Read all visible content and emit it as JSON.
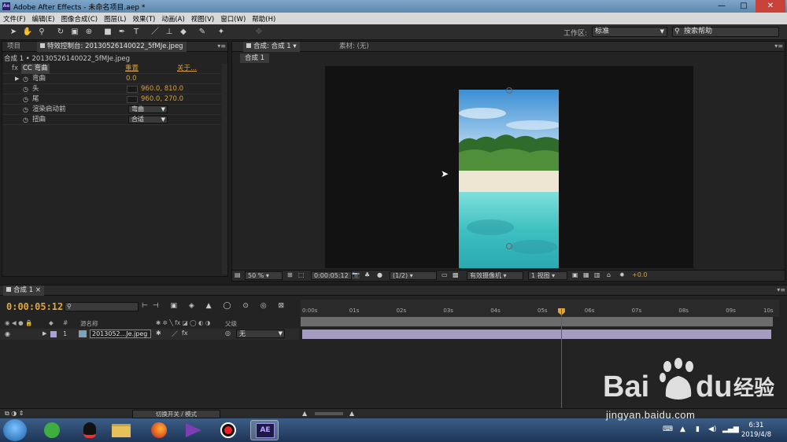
{
  "window": {
    "title": "Adobe After Effects - 未命名项目.aep *",
    "minimize": "—",
    "maximize": "□",
    "close": "✕"
  },
  "menu": [
    "文件(F)",
    "编辑(E)",
    "图像合成(C)",
    "图层(L)",
    "效果(T)",
    "动画(A)",
    "视图(V)",
    "窗口(W)",
    "帮助(H)"
  ],
  "toolbar": {
    "workspace_label": "工作区:",
    "workspace_value": "标准",
    "search_placeholder": "搜索帮助"
  },
  "left_panel": {
    "tab_project": "项目",
    "tab_effect_controls": "特效控制台: 20130526140022_5fMJe.jpeg",
    "subheader": "合成 1 • 20130526140022_5fMJe.jpeg",
    "effect_name": "CC 弯曲",
    "reset": "重置",
    "about": "关于...",
    "properties": {
      "bend_label": "弯曲",
      "bend_value": "0.0",
      "head_label": "头",
      "head_value": "960.0, 810.0",
      "tail_label": "尾",
      "tail_value": "960.0, 270.0",
      "render_prestart_label": "渲染启动前",
      "render_prestart_value": "弯曲",
      "distort_label": "扭曲",
      "distort_value": "合适"
    }
  },
  "comp_panel": {
    "tab_comp": "合成: 合成 1",
    "tab_footage": "素材: (无)",
    "subtab": "合成 1",
    "footer": {
      "zoom": "50 %",
      "timecode": "0:00:05:12",
      "resolution": "(1/2)",
      "camera": "有效摄像机",
      "views": "1 视图",
      "exposure": "+0.0"
    }
  },
  "timeline": {
    "tab": "合成 1",
    "timecode": "0:00:05:12",
    "col_hash": "#",
    "col_source": "源名称",
    "col_parent": "父级",
    "layer": {
      "index": "1",
      "name": "2013052...Je.jpeg",
      "parent": "无"
    },
    "ticks": [
      "0:00s",
      "01s",
      "02s",
      "03s",
      "04s",
      "05s",
      "06s",
      "07s",
      "08s",
      "09s",
      "10s"
    ],
    "playhead_seconds": 5.5,
    "switch_mode": "切换开关 / 模式"
  },
  "taskbar": {
    "time": "6:31",
    "date": "2019/4/8",
    "ae_label": "AE"
  },
  "watermark": {
    "text": "jingyan.baidu.com"
  }
}
